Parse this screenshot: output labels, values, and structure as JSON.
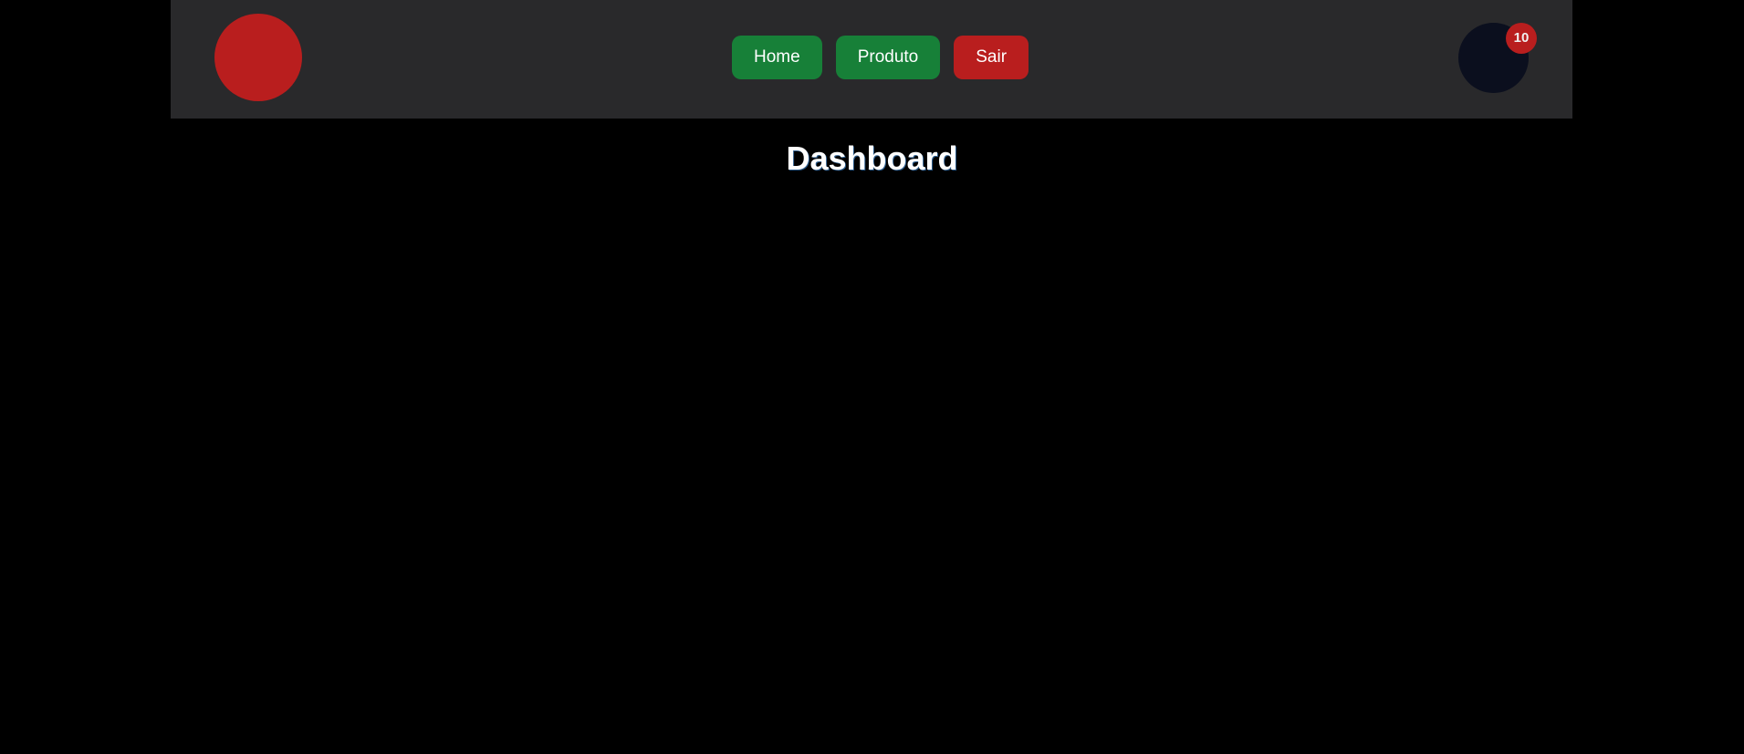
{
  "header": {
    "logo_color": "#b91e1e",
    "nav": [
      {
        "label": "Home",
        "color": "#178038"
      },
      {
        "label": "Produto",
        "color": "#178038"
      },
      {
        "label": "Sair",
        "color": "#b91e1e"
      }
    ],
    "avatar_color": "#0b0f1e",
    "notification_count": "10",
    "badge_color": "#b91e1e"
  },
  "main": {
    "title": "Dashboard"
  }
}
